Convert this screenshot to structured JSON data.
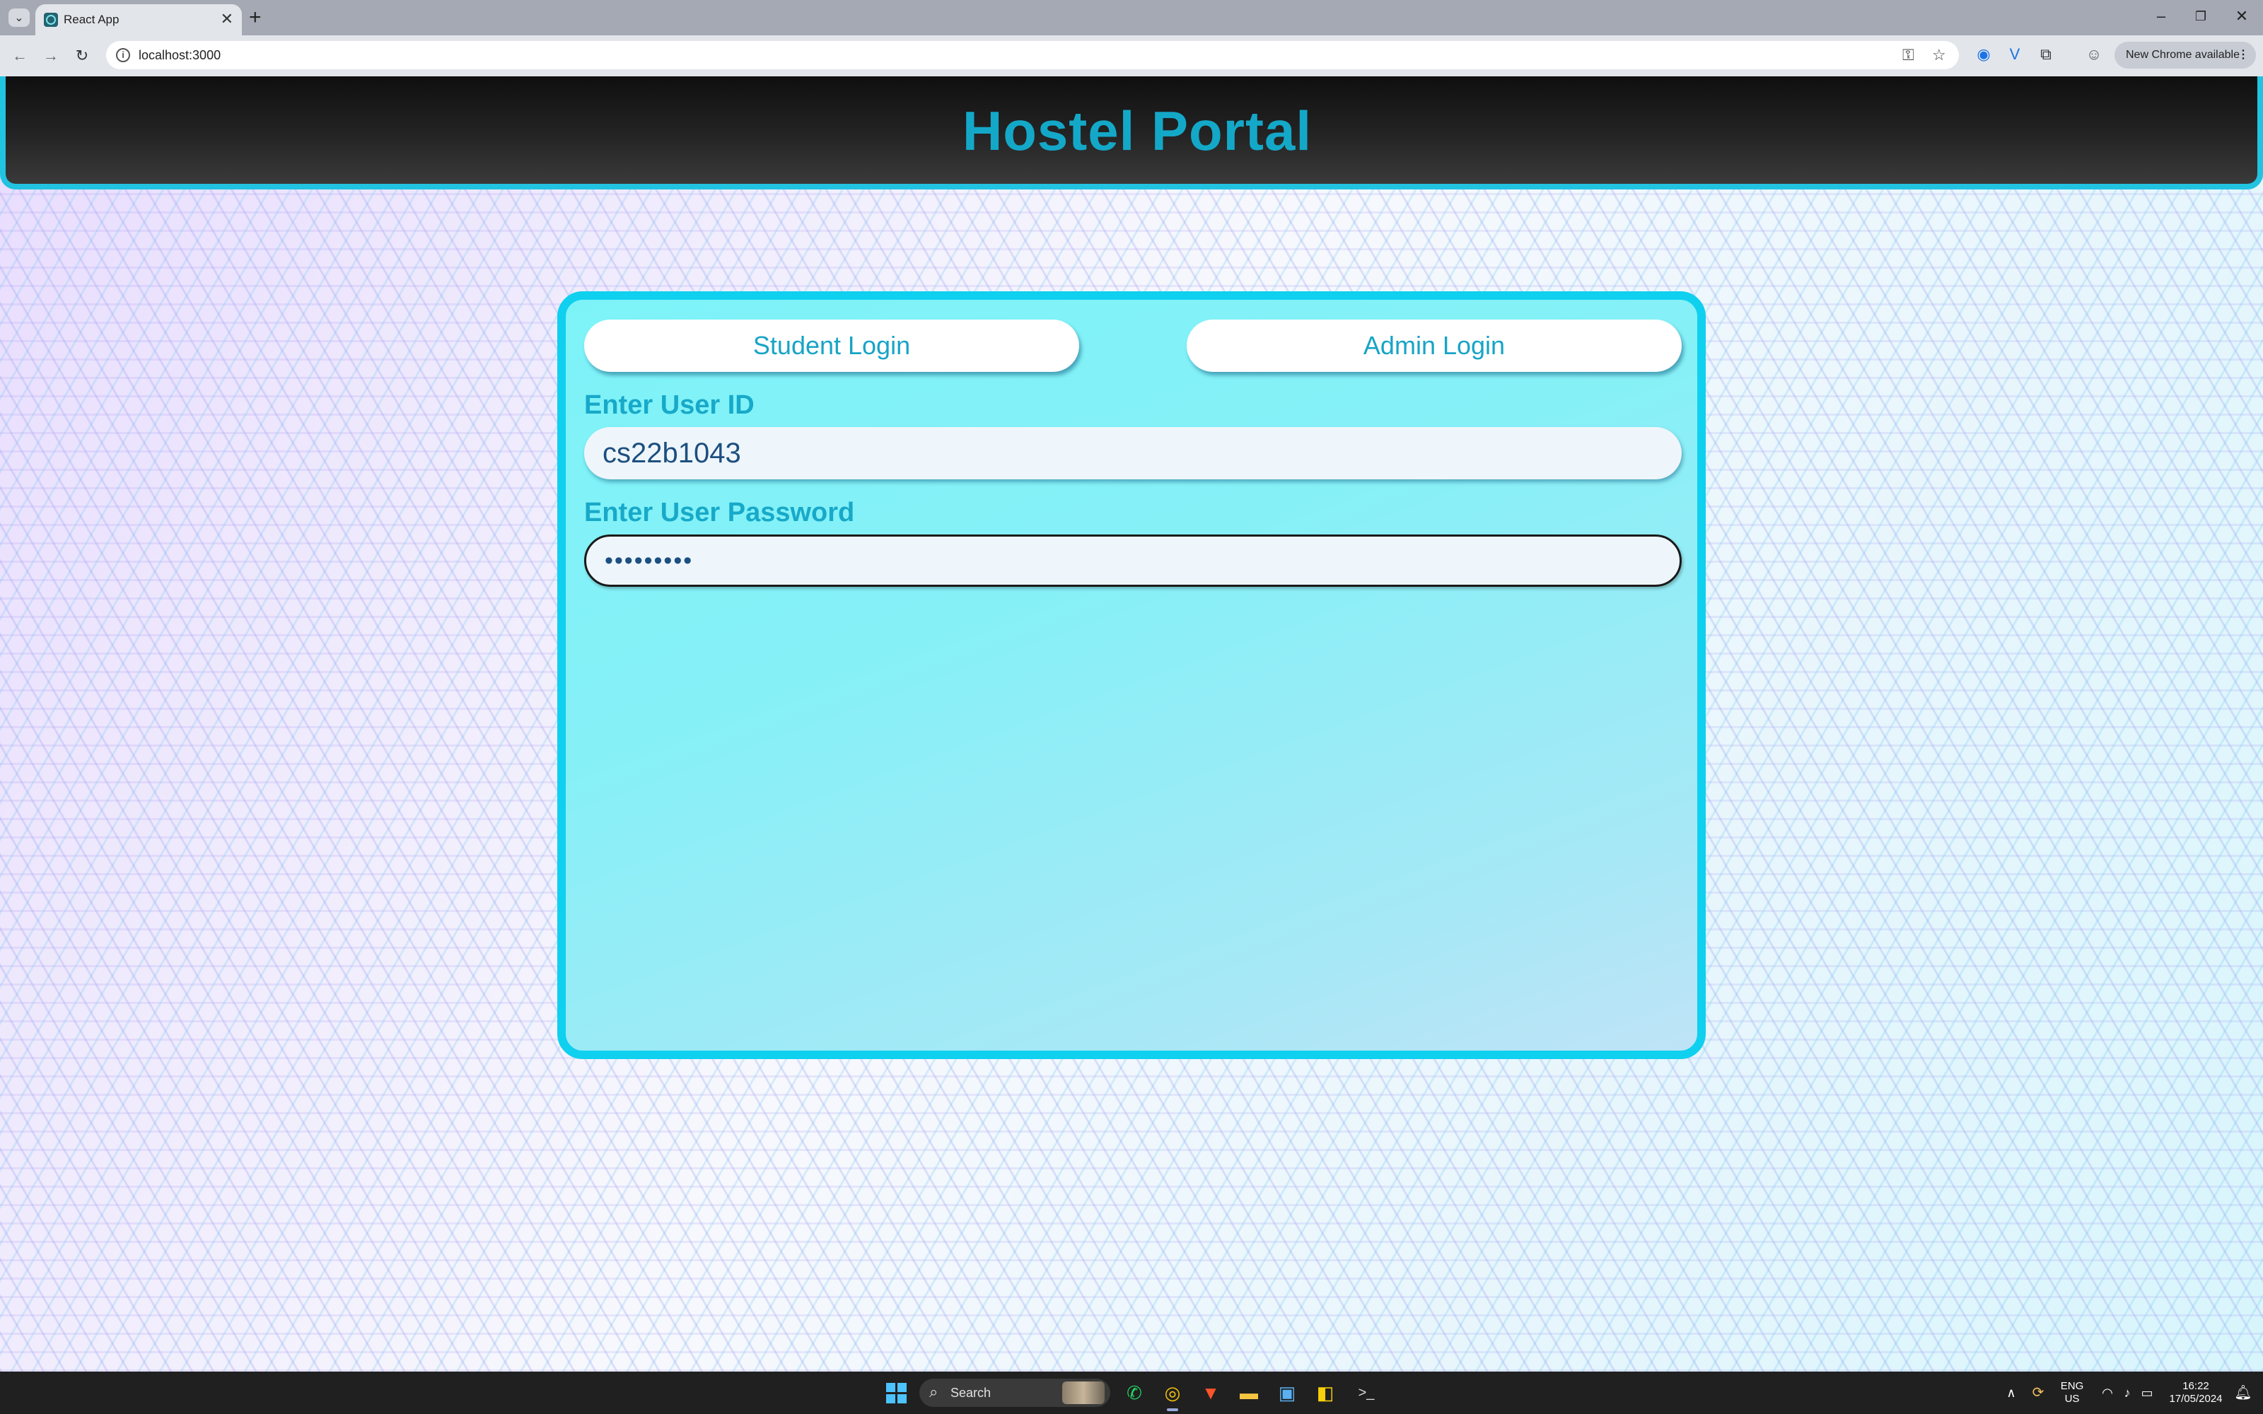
{
  "browser": {
    "tab_title": "React App",
    "url": "localhost:3000",
    "update_button": "New Chrome available",
    "new_tab_glyph": "+",
    "close_glyph": "✕"
  },
  "app": {
    "title": "Hostel Portal",
    "tabs": {
      "student": "Student Login",
      "admin": "Admin Login"
    },
    "form": {
      "userid_label": "Enter User ID",
      "userid_value": "cs22b1043",
      "password_label": "Enter User Password",
      "password_value": "•••••••••"
    }
  },
  "taskbar": {
    "search_placeholder": "Search",
    "language": "ENG",
    "region": "US",
    "time": "16:22",
    "date": "17/05/2024"
  },
  "colors": {
    "accent": "#14a8c8",
    "card_border": "#0fd0ee",
    "header_border": "#22c3e0"
  }
}
